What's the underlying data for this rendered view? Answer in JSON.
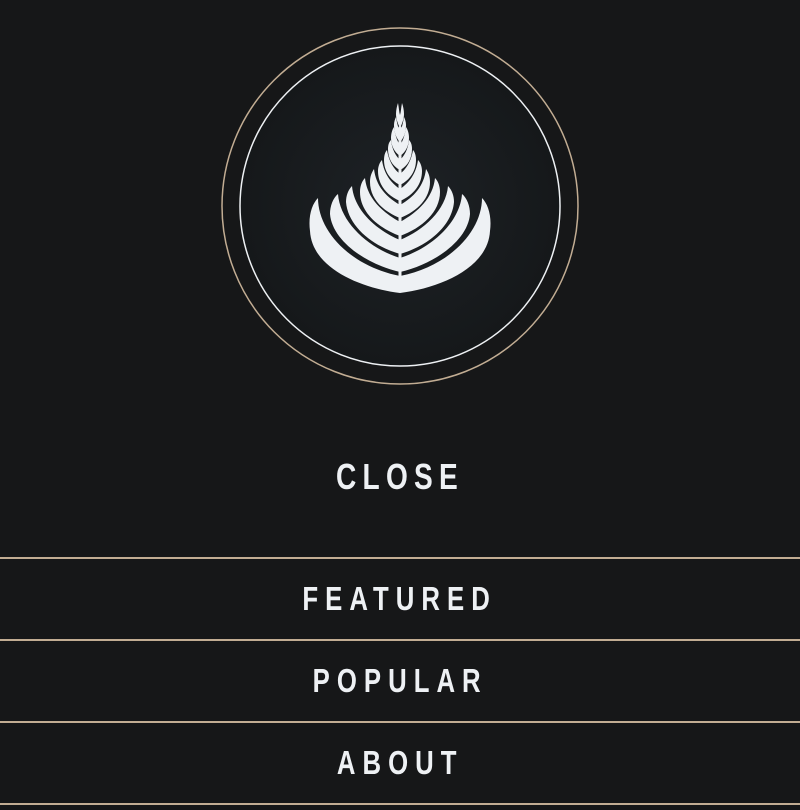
{
  "logo": {
    "icon": "latte-art-rosetta-icon"
  },
  "nav": {
    "close_label": "CLOSE",
    "items": [
      {
        "label": "FEATURED"
      },
      {
        "label": "POPULAR"
      },
      {
        "label": "ABOUT"
      }
    ]
  },
  "colors": {
    "background": "#161718",
    "accent": "#c2ad93",
    "text": "#eef1f4",
    "logo_fill": "#1b1e21"
  }
}
